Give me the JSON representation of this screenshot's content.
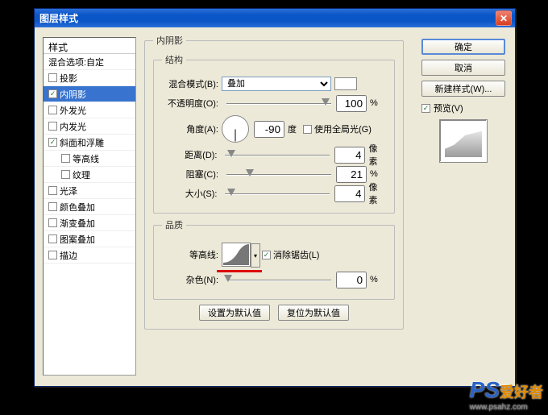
{
  "window": {
    "title": "图层样式"
  },
  "styles_list": {
    "header": "样式",
    "blend_header": "混合选项:自定",
    "items": [
      {
        "label": "投影",
        "checked": false,
        "selected": false,
        "indent": false
      },
      {
        "label": "内阴影",
        "checked": true,
        "selected": true,
        "indent": false
      },
      {
        "label": "外发光",
        "checked": false,
        "selected": false,
        "indent": false
      },
      {
        "label": "内发光",
        "checked": false,
        "selected": false,
        "indent": false
      },
      {
        "label": "斜面和浮雕",
        "checked": true,
        "selected": false,
        "indent": false
      },
      {
        "label": "等高线",
        "checked": false,
        "selected": false,
        "indent": true
      },
      {
        "label": "纹理",
        "checked": false,
        "selected": false,
        "indent": true
      },
      {
        "label": "光泽",
        "checked": false,
        "selected": false,
        "indent": false
      },
      {
        "label": "颜色叠加",
        "checked": false,
        "selected": false,
        "indent": false
      },
      {
        "label": "渐变叠加",
        "checked": false,
        "selected": false,
        "indent": false
      },
      {
        "label": "图案叠加",
        "checked": false,
        "selected": false,
        "indent": false
      },
      {
        "label": "描边",
        "checked": false,
        "selected": false,
        "indent": false
      }
    ]
  },
  "panel": {
    "title": "内阴影",
    "structure": {
      "legend": "结构",
      "blend_mode_label": "混合模式(B):",
      "blend_mode_value": "叠加",
      "opacity_label": "不透明度(O):",
      "opacity_value": "100",
      "opacity_unit": "%",
      "angle_label": "角度(A):",
      "angle_value": "-90",
      "angle_unit": "度",
      "global_light_label": "使用全局光(G)",
      "global_light_checked": false,
      "distance_label": "距离(D):",
      "distance_value": "4",
      "distance_unit": "像素",
      "choke_label": "阻塞(C):",
      "choke_value": "21",
      "choke_unit": "%",
      "size_label": "大小(S):",
      "size_value": "4",
      "size_unit": "像素"
    },
    "quality": {
      "legend": "品质",
      "contour_label": "等高线:",
      "antialias_label": "消除锯齿(L)",
      "antialias_checked": true,
      "noise_label": "杂色(N):",
      "noise_value": "0",
      "noise_unit": "%"
    },
    "buttons": {
      "set_default": "设置为默认值",
      "reset_default": "复位为默认值"
    }
  },
  "right": {
    "ok": "确定",
    "cancel": "取消",
    "new_style": "新建样式(W)...",
    "preview_label": "预览(V)",
    "preview_checked": true
  },
  "watermark": {
    "ps": "PS",
    "cn": "爱好者",
    "url": "www.psahz.com"
  }
}
